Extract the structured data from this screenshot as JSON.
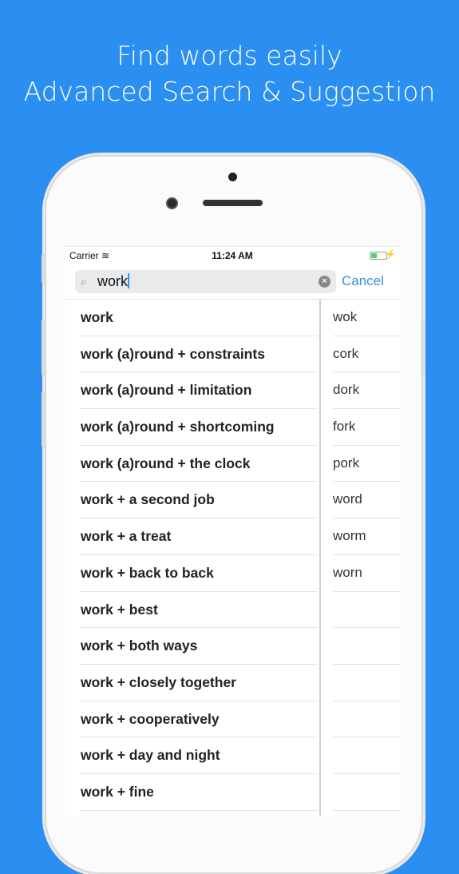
{
  "headline": {
    "line1": "Find words easily",
    "line2": "Advanced Search & Suggestion"
  },
  "status": {
    "carrier": "Carrier",
    "time": "11:24 AM"
  },
  "search": {
    "value": "work",
    "cancel_label": "Cancel"
  },
  "results": [
    "work",
    "work (a)round + constraints",
    "work (a)round + limitation",
    "work (a)round + shortcoming",
    "work (a)round + the clock",
    "work + a second job",
    "work + a treat",
    "work + back to back",
    "work + best",
    "work + both ways",
    "work + closely together",
    "work + cooperatively",
    "work + day and night",
    "work + fine"
  ],
  "suggestions": [
    "wok",
    "cork",
    "dork",
    "fork",
    "pork",
    "word",
    "worm",
    "worn",
    "",
    "",
    "",
    "",
    "",
    ""
  ],
  "colors": {
    "background": "#2b8ff1",
    "accent": "#3c90d8"
  }
}
